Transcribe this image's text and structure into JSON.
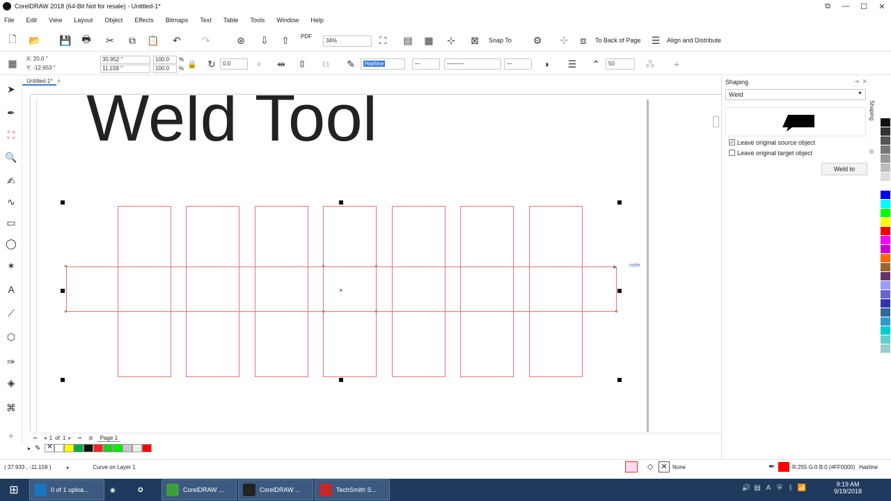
{
  "window": {
    "title": "CorelDRAW 2018 (64-Bit Not for resale) - Untitled-1*",
    "controls": [
      "restore-icon",
      "minimize-icon",
      "maximize-icon",
      "close-icon"
    ]
  },
  "menu": [
    "File",
    "Edit",
    "View",
    "Layout",
    "Object",
    "Effects",
    "Bitmaps",
    "Text",
    "Table",
    "Tools",
    "Window",
    "Help"
  ],
  "toolbar1": {
    "zoom": "34%",
    "snap_label": "Snap To",
    "back_of_page_label": "To Back of Page",
    "align_label": "Align and Distribute",
    "pdf_label": "PDF"
  },
  "toolbar2": {
    "x": "X: 20.0 \"",
    "y": "Y: -12.653 \"",
    "w": "35.952 \"",
    "h": "11.159 \"",
    "scale_w": "100.0",
    "scale_h": "100.0",
    "pct": "%",
    "rotation": "0.0",
    "outline": "Hairline",
    "miter": "50"
  },
  "document": {
    "tab": "Untitled-1*",
    "headline": "Weld Tool",
    "node_label": "node"
  },
  "pagenav": {
    "current": "1",
    "of": "of",
    "total": "1",
    "page_tab": "Page 1"
  },
  "status": {
    "coords": "( 37.933 , -11.159 )",
    "object_info": "Curve on Layer 1",
    "fill_label": "None",
    "outline_color": "R:255 G:0 B:0 (#FF0000)",
    "outline_width": "Hairline"
  },
  "docker": {
    "title": "Shaping",
    "mode": "Weld",
    "opt_source": "Leave original source object",
    "opt_target": "Leave original target object",
    "source_checked": "✓",
    "apply_label": "Weld to",
    "tab_label": "Shaping"
  },
  "palette_bottom": [
    "#ffffff",
    "#ffff00",
    "#00aa44",
    "#111111",
    "#ff2222",
    "#22cc22",
    "#00ee00",
    "#c8c8c8",
    "#eeeeee",
    "#ff0000"
  ],
  "palette_right": [
    "#111111",
    "#333333",
    "#555555",
    "#777777",
    "#999999",
    "#bbbbbb",
    "#dddddd",
    "#ffffff",
    "#0000ff",
    "#00ffff",
    "#00ff00",
    "#ffff00",
    "#ff0000",
    "#ff00ff",
    "#cc00cc",
    "#ff6600",
    "#996633",
    "#663366",
    "#9999ff",
    "#6666cc",
    "#3333aa",
    "#336699",
    "#3399cc",
    "#00cccc",
    "#66cccc",
    "#99cccc"
  ],
  "taskbar": {
    "items": [
      {
        "label": "0 of 1 uploa...",
        "color": "#1e73be"
      },
      {
        "label": "CorelDRAW ...",
        "color": "#3e9e3e"
      },
      {
        "label": "CorelDRAW ...",
        "color": "#222222"
      },
      {
        "label": "TechSmith S...",
        "color": "#c62828"
      }
    ],
    "time": "9:19 AM",
    "date": "9/19/2018"
  }
}
